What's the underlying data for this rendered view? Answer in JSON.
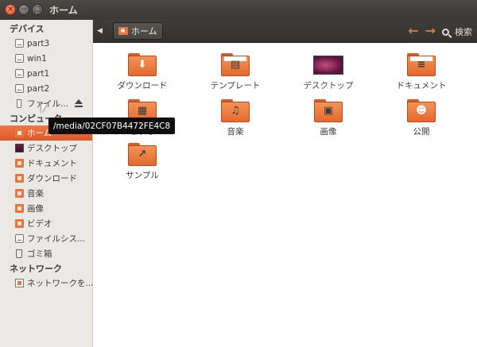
{
  "window": {
    "title": "ホーム"
  },
  "toolbar": {
    "path_label": "ホーム",
    "search_label": "検索"
  },
  "sidebar": {
    "sections": [
      {
        "label": "デバイス",
        "items": [
          {
            "label": "part3",
            "icon": "disk-icon"
          },
          {
            "label": "win1",
            "icon": "disk-icon"
          },
          {
            "label": "part1",
            "icon": "disk-icon"
          },
          {
            "label": "part2",
            "icon": "disk-icon"
          },
          {
            "label": "ファイル...",
            "icon": "usb-icon",
            "eject": true
          }
        ]
      },
      {
        "label": "コンピュータ",
        "items": [
          {
            "label": "ホーム",
            "icon": "home-folder-icon",
            "active": true
          },
          {
            "label": "デスクトップ",
            "icon": "desktop-icon"
          },
          {
            "label": "ドキュメント",
            "icon": "documents-icon"
          },
          {
            "label": "ダウンロード",
            "icon": "downloads-icon"
          },
          {
            "label": "音楽",
            "icon": "music-icon"
          },
          {
            "label": "画像",
            "icon": "pictures-icon"
          },
          {
            "label": "ビデオ",
            "icon": "videos-icon"
          },
          {
            "label": "ファイルシス...",
            "icon": "filesystem-icon"
          },
          {
            "label": "ゴミ箱",
            "icon": "trash-icon"
          }
        ]
      },
      {
        "label": "ネットワーク",
        "items": [
          {
            "label": "ネットワークを...",
            "icon": "network-icon"
          }
        ]
      }
    ]
  },
  "main": {
    "tiles": [
      {
        "label": "ダウンロード",
        "emblem": "⬇"
      },
      {
        "label": "テンプレート",
        "emblem": "▤"
      },
      {
        "label": "デスクトップ",
        "emblem": ""
      },
      {
        "label": "ドキュメント",
        "emblem": "≡"
      },
      {
        "label": "ビデオ",
        "emblem": "▦"
      },
      {
        "label": "音楽",
        "emblem": "♫"
      },
      {
        "label": "画像",
        "emblem": "▣"
      },
      {
        "label": "公開",
        "emblem": "☻"
      },
      {
        "label": "サンプル",
        "emblem": "↗"
      }
    ]
  },
  "tooltip": {
    "text": "/media/02CF07B4472FE4C8"
  }
}
